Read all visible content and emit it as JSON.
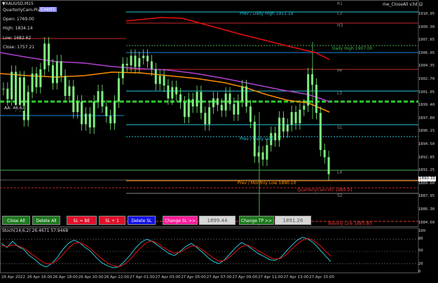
{
  "header": {
    "symbol": "XAUUSD,M15",
    "indicator": "QuarterlyCam-Piv",
    "badge": "Coast1",
    "ea_name": "me_CloseAll v3d"
  },
  "info_panel": {
    "open": "Open: 1769.00",
    "high": "High: 1834.14",
    "low": "Low: 1682.62",
    "close": "Close: 1757.21",
    "aa": "AA: 46.61"
  },
  "levels": {
    "r1": "R1",
    "r3": "L3",
    "h3": "H3",
    "pp": "PP",
    "l3": "L3",
    "s1": "S1",
    "l4": "L4",
    "s2": "S2",
    "prev_daily_high": "Prev / Daily High 1911.19",
    "daily_high": "Daily High 1907.00",
    "prev_daily_low": "Prev / Daily Low",
    "prev_monthly_low": "Prev / Monthly Low 1890.10",
    "quarterly_cam": "QuarterlyCam H5 1889.91",
    "weekly_low": "Weekly Low 1885.80"
  },
  "price_axis": [
    "1910.95",
    "1909.30",
    "1907.65",
    "1906.05",
    "1904.35",
    "1902.70",
    "1901.05",
    "1899.40",
    "1897.80",
    "1896.15",
    "1894.50",
    "1892.85",
    "1891.25",
    "1889.60",
    "1887.95",
    "1886.30",
    "1884.60"
  ],
  "current_price": "1890.33",
  "time_axis": [
    "26 Apr 2022",
    "26 Apr 16:00",
    "26 Apr 18:00",
    "26 Apr 20:00",
    "26 Apr 22:00",
    "27 Apr 01:00",
    "27 Apr 03:00",
    "27 Apr 05:00",
    "27 Apr 07:00",
    "27 Apr 09:00",
    "27 Apr 11:00",
    "27 Apr 13:00",
    "27 Apr 15:00"
  ],
  "buttons": {
    "close_all": "Close All",
    "delete_all": "Delete All",
    "sl_be": "SL = BE",
    "sl_plus": "SL + 1",
    "delete_sl": "Delete SL",
    "change_sl": "Change SL >>",
    "sl_value": "1899.44",
    "change_tp": "Change TP >>",
    "tp_value": "1891.26"
  },
  "stoch": {
    "label": "Stoch(14,6,2) 26.4671 57.9468",
    "scale": [
      "100",
      "80",
      "50",
      "20",
      "0"
    ]
  },
  "colors": {
    "green_btn": "#1e7a1e",
    "red_btn": "#e0102a",
    "blue_btn": "#1414e6",
    "pink_btn": "#ff1c9a",
    "ma_red": "#e81010",
    "ma_purple": "#b040d0",
    "ma_orange": "#ff8c00",
    "candle": "#7ff07f"
  },
  "chart_data": {
    "type": "candlestick",
    "closes": [
      1901.5,
      1900.2,
      1903.6,
      1899.5,
      1902.9,
      1897.6,
      1901.1,
      1903.4,
      1901.7,
      1903.9,
      1907.1,
      1904.4,
      1902.2,
      1904.9,
      1903.1,
      1900.6,
      1901.8,
      1898.6,
      1899.9,
      1897.1,
      1898.4,
      1896.7,
      1899.9,
      1901.2,
      1899.3,
      1898.1,
      1897.2,
      1899.9,
      1902.8,
      1904.6,
      1904.4,
      1905.6,
      1904.2,
      1905.3,
      1905.6,
      1904.9,
      1903.9,
      1902.1,
      1903.1,
      1901.9,
      1900.3,
      1901.7,
      1900.8,
      1899.8,
      1898.0,
      1900.2,
      1899.3,
      1901.1,
      1898.5,
      1897.1,
      1899.2,
      1900.3,
      1899.5,
      1898.8,
      1900.9,
      1899.6,
      1898.3,
      1900.0,
      1901.8,
      1899.3,
      1897.4,
      1893.1,
      1893.6,
      1892.7,
      1894.5,
      1896.0,
      1895.1,
      1897.9,
      1896.2,
      1897.0,
      1898.6,
      1897.2,
      1898.9,
      1899.4,
      1903.3,
      1902.0,
      1898.5,
      1893.9,
      1893.0,
      1890.9
    ],
    "price_min": 1884.6,
    "price_max": 1910.95
  }
}
